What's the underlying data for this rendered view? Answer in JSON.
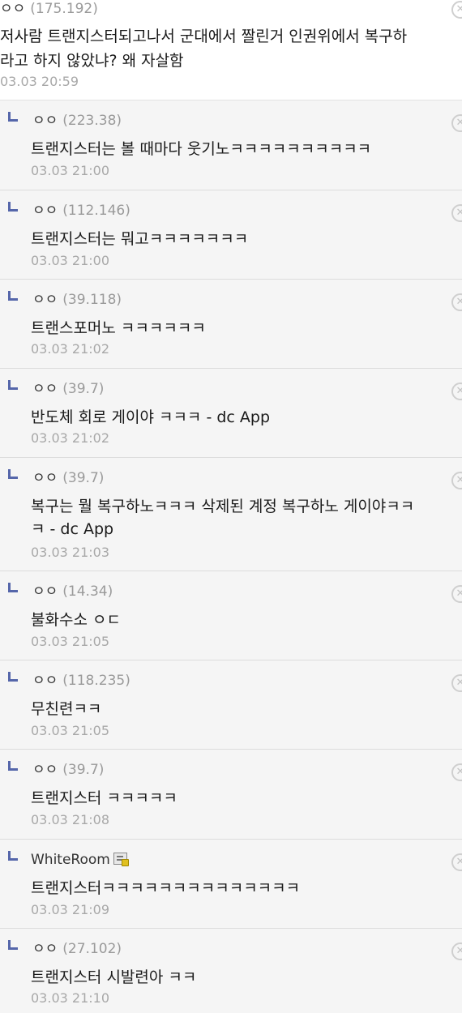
{
  "top_comment": {
    "author": "ㅇㅇ",
    "ip": "(175.192)",
    "text": "저사람 트랜지스터되고나서 군대에서 짤린거 인권위에서 복구하\n라고 하지 않았냐? 왜 자살함",
    "date": "03.03 20:59"
  },
  "replies": [
    {
      "author": "ㅇㅇ",
      "ip": "(223.38)",
      "text": "트랜지스터는 볼 때마다 웃기노ㅋㅋㅋㅋㅋㅋㅋㅋㅋㅋ",
      "date": "03.03 21:00"
    },
    {
      "author": "ㅇㅇ",
      "ip": "(112.146)",
      "text": "트랜지스터는 뭐고ㅋㅋㅋㅋㅋㅋㅋ",
      "date": "03.03 21:00"
    },
    {
      "author": "ㅇㅇ",
      "ip": "(39.118)",
      "text": "트랜스포머노 ㅋㅋㅋㅋㅋㅋ",
      "date": "03.03 21:02"
    },
    {
      "author": "ㅇㅇ",
      "ip": "(39.7)",
      "text": "반도체 회로 게이야 ㅋㅋㅋ - dc App",
      "date": "03.03 21:02"
    },
    {
      "author": "ㅇㅇ",
      "ip": "(39.7)",
      "text": "복구는 뭘 복구하노ㅋㅋㅋ 삭제된 계정 복구하노 게이야ㅋㅋ\nㅋ - dc App",
      "date": "03.03 21:03"
    },
    {
      "author": "ㅇㅇ",
      "ip": "(14.34)",
      "text": "불화수소 ㅇㄷ",
      "date": "03.03 21:05"
    },
    {
      "author": "ㅇㅇ",
      "ip": "(118.235)",
      "text": "무친련ㅋㅋ",
      "date": "03.03 21:05"
    },
    {
      "author": "ㅇㅇ",
      "ip": "(39.7)",
      "text": "트랜지스터 ㅋㅋㅋㅋㅋ",
      "date": "03.03 21:08"
    },
    {
      "author": "WhiteRoom",
      "ip": "",
      "text": "트랜지스터ㅋㅋㅋㅋㅋㅋㅋㅋㅋㅋㅋㅋㅋㅋ",
      "date": "03.03 21:09"
    },
    {
      "author": "ㅇㅇ",
      "ip": "(27.102)",
      "text": "트랜지스터 시발련아 ㅋㅋ",
      "date": "03.03 21:10"
    }
  ],
  "icons": {
    "delete": "delete-icon",
    "reply_arrow": "reply-arrow-icon",
    "user_badge": "gallery-user-badge-icon"
  },
  "colors": {
    "reply_background": "#f5f5f5",
    "reply_arrow": "#5566aa",
    "ip_text": "#9a9a9a",
    "date_text": "#a8a8a8"
  }
}
